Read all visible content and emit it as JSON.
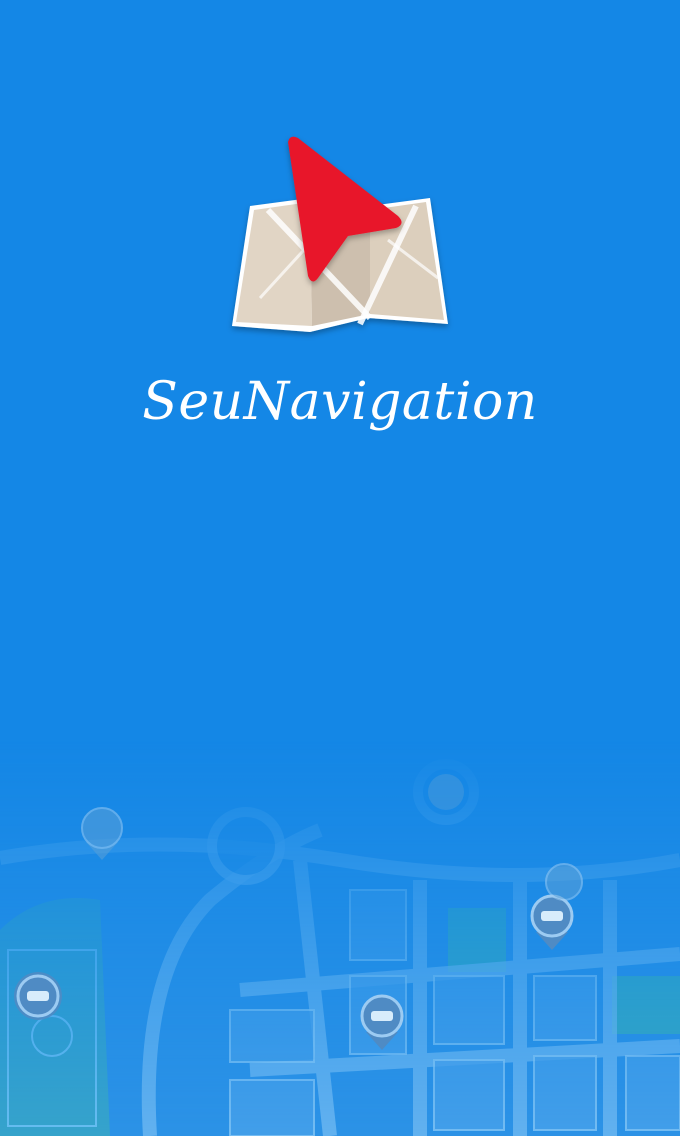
{
  "app": {
    "name": "SeuNavigation"
  },
  "icons": {
    "logo": "map-with-navigation-arrow-icon",
    "map_pins": [
      "car-pin-icon",
      "car-pin-icon",
      "car-pin-icon",
      "car-pin-icon",
      "location-pin-icon",
      "location-pin-icon"
    ]
  },
  "colors": {
    "background": "#1487e6",
    "arrow": "#e8192c",
    "map_paper": "#d8cab7",
    "title_text": "#ffffff"
  }
}
